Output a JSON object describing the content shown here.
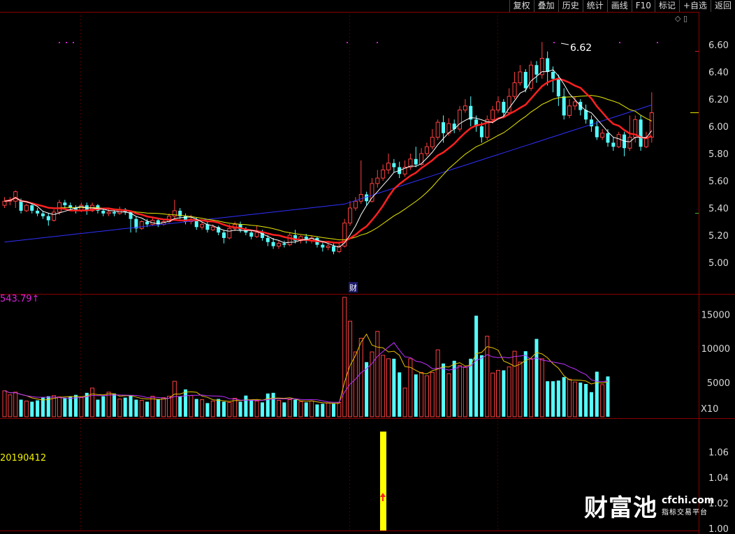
{
  "toolbar": {
    "items": [
      "复权",
      "叠加",
      "历史",
      "统计",
      "画线",
      "F10",
      "标记",
      "+自选",
      "返回"
    ]
  },
  "price_axis": [
    "6.60",
    "6.40",
    "6.20",
    "6.00",
    "5.80",
    "5.60",
    "5.40",
    "5.20",
    "5.00"
  ],
  "volume_axis": [
    "15000",
    "10000",
    "5000"
  ],
  "volume_unit": "X10",
  "indicator_axis": [
    "1.06",
    "1.04",
    "1.02",
    "1.00"
  ],
  "price_info": "543.79",
  "price_info_arrow": "↑",
  "high_marker": "6.62",
  "event_marker": "财",
  "date_label": "20190412",
  "logo": {
    "mark": "财富池",
    "domain": "cfchi.com",
    "tagline": "指标交易平台"
  },
  "panel_icons": "◇ ▯",
  "colors": {
    "up": "#ff4040",
    "down": "#54ffff",
    "ma5": "#ffffff",
    "ma10": "#ff2020",
    "ma20": "#e8e800",
    "ma60": "#3030ff",
    "signal": "#ffff00",
    "grid": "#8a0000"
  },
  "chart_data": [
    {
      "type": "candlestick",
      "title": "",
      "ylim": [
        4.8,
        6.7
      ],
      "series": [
        {
          "values": [
            [
              5.42,
              5.45,
              5.4,
              5.48
            ],
            [
              5.45,
              5.46,
              5.42,
              5.48
            ],
            [
              5.45,
              5.52,
              5.4,
              5.53
            ],
            [
              5.45,
              5.38,
              5.36,
              5.47
            ],
            [
              5.38,
              5.42,
              5.37,
              5.43
            ],
            [
              5.42,
              5.38,
              5.36,
              5.44
            ],
            [
              5.38,
              5.36,
              5.34,
              5.4
            ],
            [
              5.36,
              5.34,
              5.32,
              5.38
            ],
            [
              5.34,
              5.31,
              5.27,
              5.36
            ],
            [
              5.31,
              5.37,
              5.3,
              5.39
            ],
            [
              5.37,
              5.44,
              5.35,
              5.46
            ],
            [
              5.44,
              5.42,
              5.39,
              5.46
            ],
            [
              5.42,
              5.4,
              5.38,
              5.44
            ],
            [
              5.4,
              5.38,
              5.36,
              5.42
            ],
            [
              5.38,
              5.42,
              5.37,
              5.44
            ],
            [
              5.42,
              5.38,
              5.35,
              5.44
            ],
            [
              5.38,
              5.42,
              5.37,
              5.44
            ],
            [
              5.42,
              5.38,
              5.36,
              5.43
            ],
            [
              5.38,
              5.36,
              5.34,
              5.4
            ],
            [
              5.36,
              5.37,
              5.34,
              5.4
            ],
            [
              5.37,
              5.36,
              5.34,
              5.39
            ],
            [
              5.36,
              5.39,
              5.35,
              5.41
            ],
            [
              5.39,
              5.37,
              5.35,
              5.4
            ],
            [
              5.37,
              5.32,
              5.22,
              5.38
            ],
            [
              5.32,
              5.25,
              5.22,
              5.34
            ],
            [
              5.25,
              5.3,
              5.24,
              5.31
            ],
            [
              5.3,
              5.28,
              5.26,
              5.32
            ],
            [
              5.28,
              5.31,
              5.27,
              5.33
            ],
            [
              5.31,
              5.28,
              5.26,
              5.32
            ],
            [
              5.28,
              5.3,
              5.27,
              5.32
            ],
            [
              5.3,
              5.34,
              5.29,
              5.36
            ],
            [
              5.34,
              5.38,
              5.32,
              5.46
            ],
            [
              5.38,
              5.34,
              5.32,
              5.4
            ],
            [
              5.34,
              5.3,
              5.28,
              5.36
            ],
            [
              5.3,
              5.31,
              5.28,
              5.35
            ],
            [
              5.31,
              5.26,
              5.24,
              5.33
            ],
            [
              5.26,
              5.28,
              5.24,
              5.3
            ],
            [
              5.28,
              5.24,
              5.22,
              5.3
            ],
            [
              5.24,
              5.26,
              5.23,
              5.28
            ],
            [
              5.26,
              5.22,
              5.2,
              5.27
            ],
            [
              5.22,
              5.18,
              5.14,
              5.24
            ],
            [
              5.18,
              5.25,
              5.17,
              5.28
            ],
            [
              5.25,
              5.28,
              5.23,
              5.3
            ],
            [
              5.28,
              5.24,
              5.22,
              5.3
            ],
            [
              5.24,
              5.22,
              5.2,
              5.26
            ],
            [
              5.22,
              5.19,
              5.17,
              5.24
            ],
            [
              5.19,
              5.22,
              5.18,
              5.27
            ],
            [
              5.22,
              5.18,
              5.16,
              5.24
            ],
            [
              5.18,
              5.15,
              5.12,
              5.2
            ],
            [
              5.15,
              5.12,
              5.1,
              5.18
            ],
            [
              5.12,
              5.14,
              5.1,
              5.16
            ],
            [
              5.14,
              5.13,
              5.11,
              5.16
            ],
            [
              5.13,
              5.2,
              5.12,
              5.22
            ],
            [
              5.2,
              5.16,
              5.14,
              5.24
            ],
            [
              5.16,
              5.19,
              5.14,
              5.2
            ],
            [
              5.19,
              5.16,
              5.14,
              5.21
            ],
            [
              5.16,
              5.18,
              5.14,
              5.2
            ],
            [
              5.18,
              5.13,
              5.11,
              5.19
            ],
            [
              5.13,
              5.11,
              5.08,
              5.15
            ],
            [
              5.11,
              5.12,
              5.09,
              5.14
            ],
            [
              5.12,
              5.08,
              5.06,
              5.14
            ],
            [
              5.08,
              5.12,
              5.07,
              5.14
            ],
            [
              5.12,
              5.29,
              5.11,
              5.32
            ],
            [
              5.29,
              5.4,
              5.27,
              5.45
            ],
            [
              5.4,
              5.45,
              5.38,
              5.48
            ],
            [
              5.45,
              5.5,
              5.43,
              5.75
            ],
            [
              5.5,
              5.45,
              5.42,
              5.52
            ],
            [
              5.45,
              5.58,
              5.44,
              5.62
            ],
            [
              5.58,
              5.62,
              5.55,
              5.68
            ],
            [
              5.62,
              5.68,
              5.6,
              5.72
            ],
            [
              5.68,
              5.73,
              5.65,
              5.8
            ],
            [
              5.73,
              5.7,
              5.66,
              5.76
            ],
            [
              5.7,
              5.65,
              5.62,
              5.74
            ],
            [
              5.65,
              5.7,
              5.63,
              5.75
            ],
            [
              5.7,
              5.76,
              5.68,
              5.8
            ],
            [
              5.76,
              5.72,
              5.7,
              5.85
            ],
            [
              5.72,
              5.8,
              5.71,
              5.84
            ],
            [
              5.8,
              5.85,
              5.78,
              5.88
            ],
            [
              5.85,
              5.92,
              5.83,
              5.98
            ],
            [
              5.92,
              6.03,
              5.9,
              6.05
            ],
            [
              6.03,
              5.95,
              5.88,
              6.08
            ],
            [
              5.95,
              6.02,
              5.93,
              6.06
            ],
            [
              6.02,
              5.98,
              5.95,
              6.05
            ],
            [
              5.98,
              6.12,
              5.96,
              6.15
            ],
            [
              6.12,
              6.15,
              6.1,
              6.2
            ],
            [
              6.15,
              6.05,
              6.0,
              6.22
            ],
            [
              6.05,
              6.0,
              5.96,
              6.08
            ],
            [
              6.0,
              5.92,
              5.88,
              6.03
            ],
            [
              5.92,
              6.05,
              5.9,
              6.08
            ],
            [
              6.05,
              6.12,
              6.02,
              6.15
            ],
            [
              6.12,
              6.18,
              6.1,
              6.22
            ],
            [
              6.18,
              6.1,
              6.06,
              6.2
            ],
            [
              6.1,
              6.22,
              6.08,
              6.28
            ],
            [
              6.22,
              6.32,
              6.2,
              6.4
            ],
            [
              6.32,
              6.4,
              6.3,
              6.45
            ],
            [
              6.4,
              6.28,
              6.25,
              6.42
            ],
            [
              6.28,
              6.45,
              6.26,
              6.48
            ],
            [
              6.45,
              6.38,
              6.32,
              6.48
            ],
            [
              6.38,
              6.5,
              6.35,
              6.62
            ],
            [
              6.5,
              6.4,
              6.3,
              6.55
            ],
            [
              6.4,
              6.35,
              6.25,
              6.44
            ],
            [
              6.35,
              6.22,
              6.15,
              6.38
            ],
            [
              6.22,
              6.08,
              6.05,
              6.28
            ],
            [
              6.08,
              6.15,
              6.06,
              6.2
            ],
            [
              6.15,
              6.18,
              6.12,
              6.22
            ],
            [
              6.18,
              6.12,
              6.08,
              6.2
            ],
            [
              6.12,
              6.05,
              6.02,
              6.16
            ],
            [
              6.05,
              6.0,
              5.96,
              6.08
            ],
            [
              6.0,
              5.92,
              5.9,
              6.04
            ],
            [
              5.92,
              5.95,
              5.9,
              5.98
            ],
            [
              5.95,
              5.88,
              5.85,
              5.98
            ],
            [
              5.88,
              5.85,
              5.82,
              5.92
            ],
            [
              5.85,
              5.94,
              5.84,
              5.96
            ],
            [
              5.94,
              5.84,
              5.78,
              5.96
            ],
            [
              5.84,
              5.92,
              5.82,
              6.08
            ],
            [
              5.92,
              6.05,
              5.88,
              6.08
            ],
            [
              6.05,
              5.85,
              5.82,
              6.08
            ],
            [
              5.85,
              5.92,
              5.84,
              5.96
            ],
            [
              5.92,
              6.1,
              5.88,
              6.25
            ]
          ]
        }
      ]
    },
    {
      "type": "bar",
      "title": "",
      "ylim": [
        0,
        18000
      ],
      "series": [
        {
          "values": [
            3800,
            3200,
            3600,
            2500,
            2300,
            2200,
            2400,
            2800,
            3000,
            3100,
            2900,
            2700,
            3000,
            3200,
            2800,
            3500,
            4200,
            2500,
            3000,
            3600,
            3400,
            2600,
            2800,
            3100,
            2500,
            2400,
            2200,
            3000,
            2600,
            2800,
            3000,
            5200,
            3000,
            4000,
            3100,
            2600,
            2500,
            2000,
            2300,
            2600,
            2200,
            2100,
            2700,
            2200,
            3100,
            2400,
            2300,
            2100,
            3400,
            3500,
            2400,
            2100,
            2500,
            2500,
            2200,
            2100,
            2300,
            1800,
            1900,
            2000,
            1900,
            2100,
            17500,
            14000,
            9500,
            11500,
            8000,
            9500,
            12500,
            9000,
            8500,
            8500,
            6500,
            4200,
            8500,
            6200,
            6500,
            6000,
            6500,
            9800,
            7800,
            6300,
            8200,
            7500,
            7300,
            8500,
            14800,
            9000,
            11800,
            6400,
            6800,
            6800,
            7300,
            9600,
            8000,
            9600,
            8500,
            11400,
            8500,
            5200,
            5200,
            5300,
            5800,
            5500,
            5100,
            5000,
            4800,
            3600,
            6600,
            4700,
            5900
          ]
        }
      ]
    },
    {
      "type": "bar",
      "title": "",
      "ylim": [
        1.0,
        1.08
      ],
      "series": [
        {
          "values": [
            1.076
          ]
        }
      ]
    }
  ]
}
